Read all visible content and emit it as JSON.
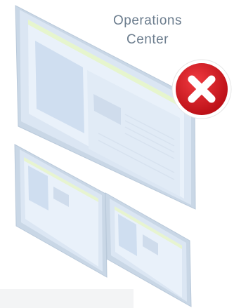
{
  "diagram": {
    "title_lines": [
      "Operations",
      "Center"
    ],
    "status_icon": "error-x-icon",
    "status_color": "#d8141c",
    "monitor_color": "#dde8f5",
    "accent_color": "#e6f5c8"
  }
}
